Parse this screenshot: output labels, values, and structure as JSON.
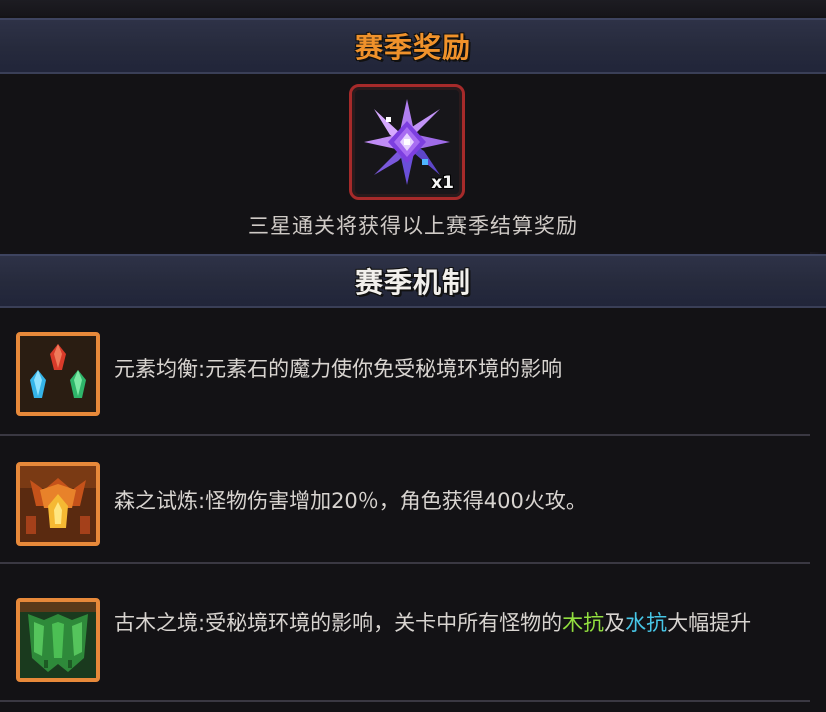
{
  "reward_section": {
    "title": "赛季奖励",
    "item": {
      "icon": "purple-shuriken-star-icon",
      "count": "x1"
    },
    "caption": "三星通关将获得以上赛季结算奖励"
  },
  "mechanics_section": {
    "title": "赛季机制",
    "items": [
      {
        "icon": "elemental-crystals-icon",
        "text": "元素均衡:元素石的魔力使你免受秘境环境的影响"
      },
      {
        "icon": "fire-forest-trial-icon",
        "text": "森之试炼:怪物伤害增加20％，角色获得400火攻。"
      },
      {
        "icon": "ancient-wood-leaf-icon",
        "text_before": "古木之境:受秘境环境的影响，关卡中所有怪物的",
        "highlight_1": "木抗",
        "connector": "及",
        "highlight_2": "水抗",
        "text_after": "大幅提升"
      }
    ]
  },
  "colors": {
    "reward_title": "#f0922b",
    "mech_title": "#f2f0ec",
    "wood_resist": "#92df3f",
    "water_resist": "#47c6e6",
    "icon_border": "#e7893a",
    "reward_border": "#a62a2a"
  }
}
